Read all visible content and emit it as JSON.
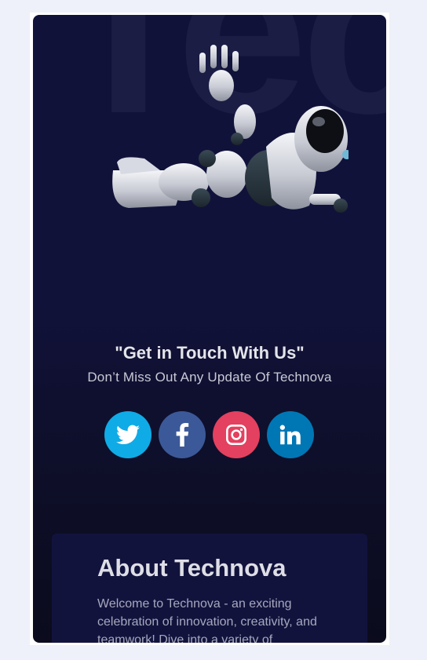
{
  "hero": {
    "watermark": "Tec",
    "headline": "\"Get in Touch With Us\"",
    "subline": "Don’t Miss Out Any Update Of Technova"
  },
  "socials": [
    {
      "name": "twitter",
      "icon": "twitter-icon",
      "color": "#0fabe6"
    },
    {
      "name": "facebook",
      "icon": "facebook-icon",
      "color": "#3b5998"
    },
    {
      "name": "instagram",
      "icon": "instagram-icon",
      "color": "#e4405f"
    },
    {
      "name": "linkedin",
      "icon": "linkedin-icon",
      "color": "#0077b5"
    }
  ],
  "about": {
    "title": "About Technova",
    "body": "Welcome to Technova - an exciting celebration of innovation, creativity, and teamwork! Dive into a variety of"
  },
  "colors": {
    "page_bg": "#eef1f9",
    "card_top": "#11123a",
    "card_bottom": "#0b0b1d",
    "about_bg": "#12133d"
  }
}
